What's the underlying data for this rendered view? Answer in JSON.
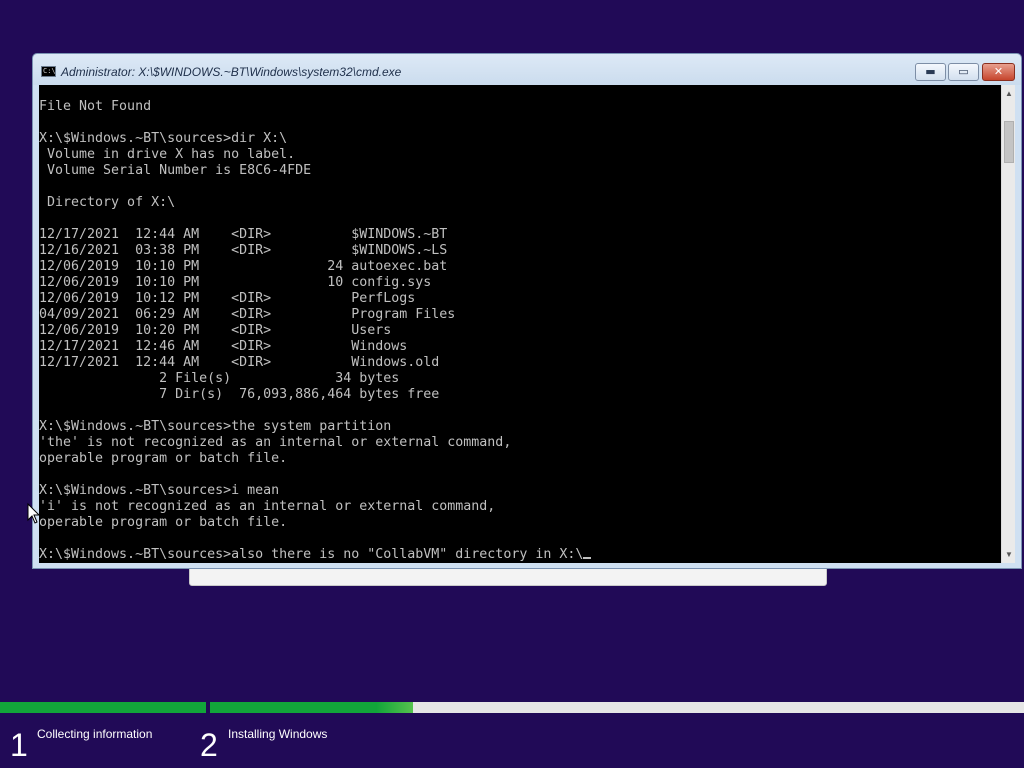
{
  "window": {
    "title": "Administrator: X:\\$WINDOWS.~BT\\Windows\\system32\\cmd.exe",
    "app_icon_text": "C:\\",
    "minimize_symbol": "▬",
    "maximize_symbol": "▭",
    "close_symbol": "✕"
  },
  "console": {
    "lines": [
      "File Not Found",
      "",
      "X:\\$Windows.~BT\\sources>dir X:\\",
      " Volume in drive X has no label.",
      " Volume Serial Number is E8C6-4FDE",
      "",
      " Directory of X:\\",
      "",
      "12/17/2021  12:44 AM    <DIR>          $WINDOWS.~BT",
      "12/16/2021  03:38 PM    <DIR>          $WINDOWS.~LS",
      "12/06/2019  10:10 PM                24 autoexec.bat",
      "12/06/2019  10:10 PM                10 config.sys",
      "12/06/2019  10:12 PM    <DIR>          PerfLogs",
      "04/09/2021  06:29 AM    <DIR>          Program Files",
      "12/06/2019  10:20 PM    <DIR>          Users",
      "12/17/2021  12:46 AM    <DIR>          Windows",
      "12/17/2021  12:44 AM    <DIR>          Windows.old",
      "               2 File(s)             34 bytes",
      "               7 Dir(s)  76,093,886,464 bytes free",
      "",
      "X:\\$Windows.~BT\\sources>the system partition",
      "'the' is not recognized as an internal or external command,",
      "operable program or batch file.",
      "",
      "X:\\$Windows.~BT\\sources>i mean",
      "'i' is not recognized as an internal or external command,",
      "operable program or batch file.",
      ""
    ],
    "prompt_line": "X:\\$Windows.~BT\\sources>also there is no \"CollabVM\" directory in X:\\"
  },
  "scrollbar": {
    "up_arrow": "▲",
    "down_arrow": "▼"
  },
  "setup": {
    "progress_fraction": 0.403,
    "steps": [
      {
        "number": "1",
        "label": "Collecting information"
      },
      {
        "number": "2",
        "label": "Installing Windows"
      }
    ]
  },
  "colors": {
    "desktop_background": "#210a57",
    "console_background": "#000000",
    "console_text": "#c0c0c0",
    "progress_fill": "#12a53a",
    "progress_track": "#e6e6e6"
  }
}
